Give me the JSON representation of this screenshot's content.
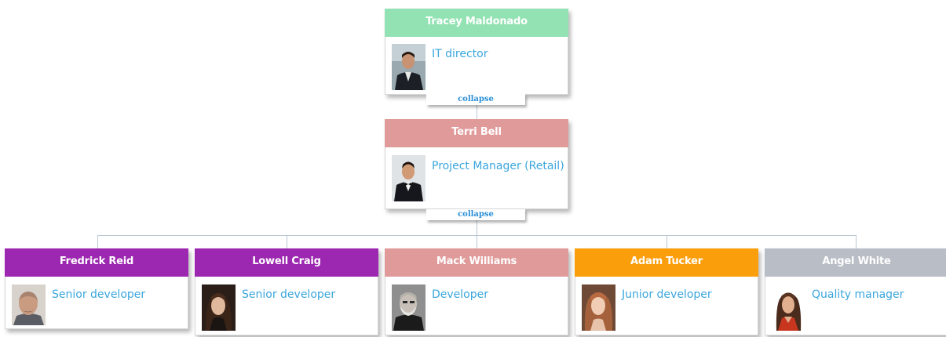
{
  "nodes": {
    "tracey": {
      "name": "Tracey Maldonado",
      "title": "IT director",
      "color": "#93e2b3"
    },
    "terri": {
      "name": "Terri Bell",
      "title": "Project Manager (Retail)",
      "color": "#e09a9a"
    },
    "fredrick": {
      "name": "Fredrick Reid",
      "title": "Senior developer",
      "color": "#9c27b0"
    },
    "lowell": {
      "name": "Lowell Craig",
      "title": "Senior developer",
      "color": "#9c27b0"
    },
    "mack": {
      "name": "Mack Williams",
      "title": "Developer",
      "color": "#e09a9a"
    },
    "adam": {
      "name": "Adam Tucker",
      "title": "Junior developer",
      "color": "#fb9e0c"
    },
    "angel": {
      "name": "Angel White",
      "title": "Quality manager",
      "color": "#b9bdc5"
    }
  },
  "collapse_label": "collapse",
  "colors": {
    "connector": "#b8c8d4",
    "title_text": "#3aa6dd",
    "collapse_text": "#2a8fd6"
  }
}
